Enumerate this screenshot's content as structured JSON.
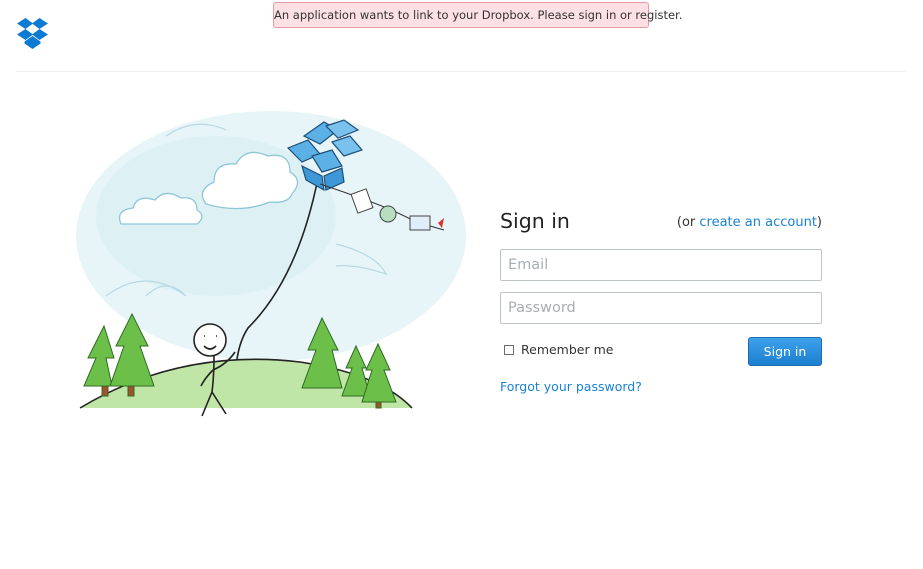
{
  "header": {
    "logo_icon": "dropbox-logo-icon",
    "brand_color": "#0d7bd4"
  },
  "banner": {
    "message": "An application wants to link to your Dropbox. Please sign in or register.",
    "background_color": "#fce0e3",
    "border_color": "#e79aa4"
  },
  "illustration": {
    "icon": "stick-figure-kite-illustration"
  },
  "signin": {
    "title": "Sign in",
    "create_prefix": "(or ",
    "create_link": "create an account",
    "create_suffix": ")",
    "email_placeholder": "Email",
    "password_placeholder": "Password",
    "remember_label": "Remember me",
    "submit_label": "Sign in",
    "forgot_link": "Forgot your password?",
    "link_color": "#1a82d6",
    "button_color": "#1d7fd0"
  }
}
